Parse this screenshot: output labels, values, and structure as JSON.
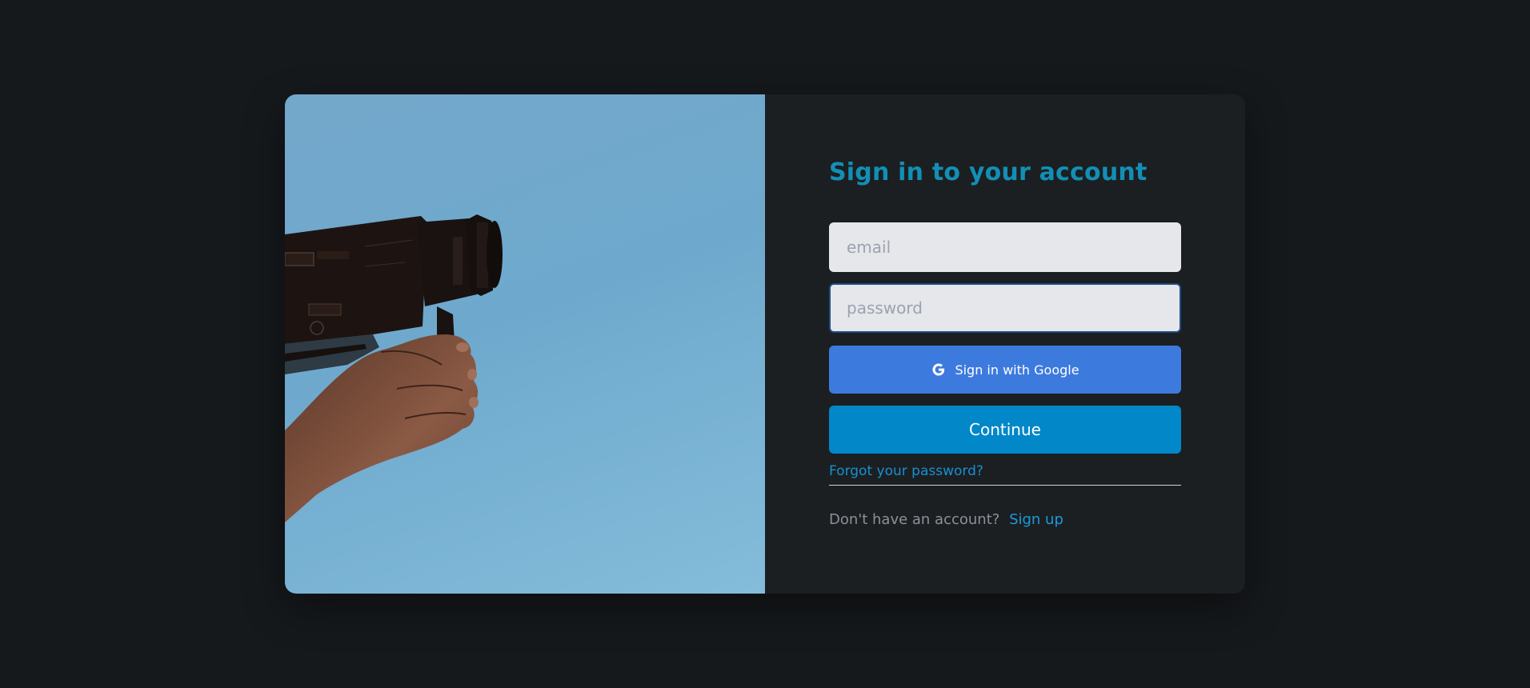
{
  "form": {
    "title": "Sign in to your account",
    "email_placeholder": "email",
    "password_placeholder": "password",
    "google_label": "Sign in with Google",
    "continue_label": "Continue",
    "forgot_label": "Forgot your password?",
    "no_account_text": "Don't have an account?",
    "signup_label": "Sign up"
  },
  "colors": {
    "background": "#16191c",
    "panel": "#1b1f22",
    "title": "#138fb5",
    "google_button": "#3d7ade",
    "continue_button": "#0287c8",
    "link": "#1691d0"
  },
  "icons": {
    "google": "google-g-icon"
  }
}
